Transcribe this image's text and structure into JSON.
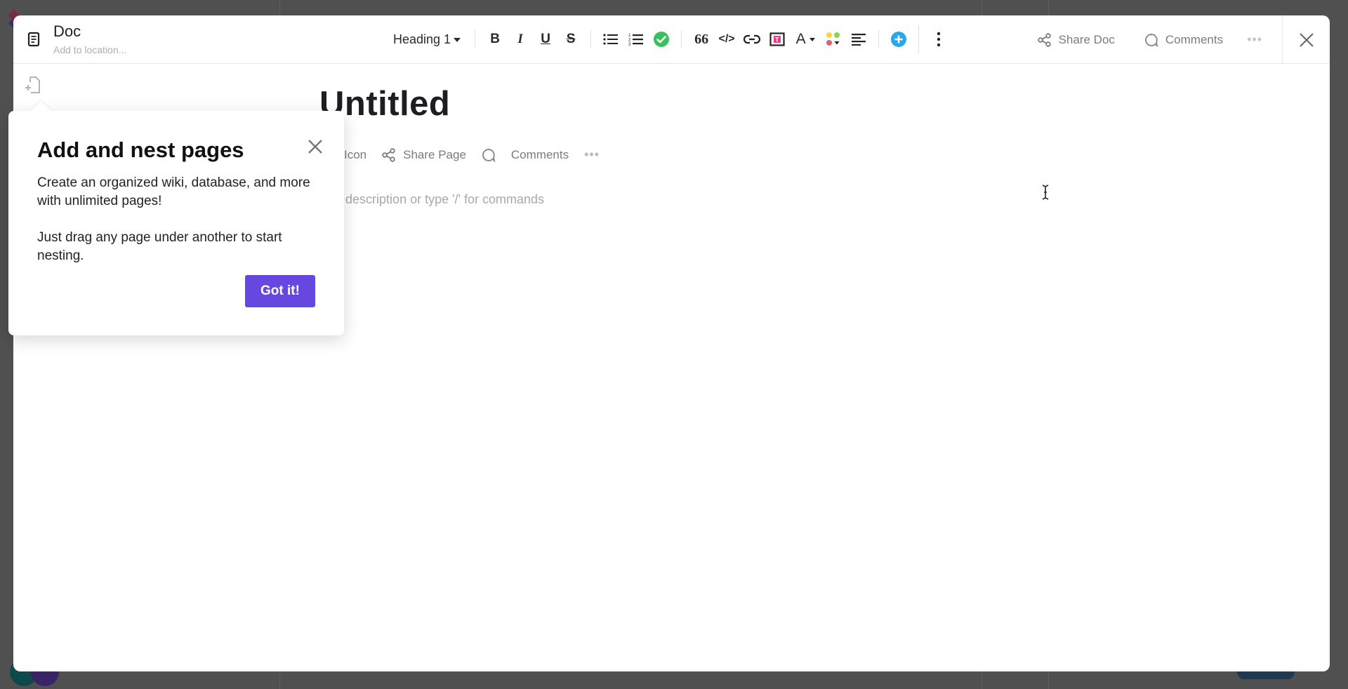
{
  "document": {
    "icon": "document-icon",
    "title": "Doc",
    "location_placeholder": "Add to location..."
  },
  "toolbar": {
    "heading_style": "Heading 1",
    "buttons": [
      {
        "name": "bold",
        "icon": "bold-icon",
        "glyph": "B"
      },
      {
        "name": "italic",
        "icon": "italic-icon",
        "glyph": "I"
      },
      {
        "name": "underline",
        "icon": "underline-icon",
        "glyph": "U"
      },
      {
        "name": "strikethrough",
        "icon": "strikethrough-icon",
        "glyph": "S"
      },
      {
        "name": "bulleted-list",
        "icon": "bulleted-list-icon"
      },
      {
        "name": "numbered-list",
        "icon": "numbered-list-icon"
      },
      {
        "name": "checklist",
        "icon": "checkmark-circle-icon"
      },
      {
        "name": "quote",
        "icon": "quote-icon",
        "glyph": "66"
      },
      {
        "name": "code",
        "icon": "code-icon",
        "glyph": "</>"
      },
      {
        "name": "link",
        "icon": "link-icon"
      },
      {
        "name": "banner",
        "icon": "text-banner-icon",
        "glyph": "T"
      },
      {
        "name": "text-color",
        "icon": "text-color-icon",
        "glyph": "A"
      },
      {
        "name": "highlight-colors",
        "icon": "color-palette-icon"
      },
      {
        "name": "align",
        "icon": "align-left-icon"
      },
      {
        "name": "insert",
        "icon": "plus-circle-icon"
      },
      {
        "name": "more",
        "icon": "vertical-dots-icon"
      }
    ],
    "colors": {
      "checklist": "#3bbf5e",
      "insert": "#2aa7e8",
      "banner": "#e83e8c",
      "palette": [
        "#f5d547",
        "#8bd35b",
        "#d9617a"
      ]
    }
  },
  "header_actions": {
    "share_doc": "Share Doc",
    "comments": "Comments",
    "more": "more-options-icon",
    "close": "close-icon"
  },
  "page": {
    "title": "Untitled",
    "actions": {
      "add_icon": "Add Icon",
      "share_page": "Share Page",
      "comments": "Comments"
    },
    "description_placeholder": "Add description or type '/' for commands",
    "description_visible": "scription or type '/' for commands"
  },
  "popover": {
    "title": "Add and nest pages",
    "paragraph_1": "Create an organized wiki, database, and more with unlimited pages!",
    "paragraph_2": "Just drag any page under another to start nesting.",
    "button": "Got it!",
    "accent": "#6647e0"
  }
}
